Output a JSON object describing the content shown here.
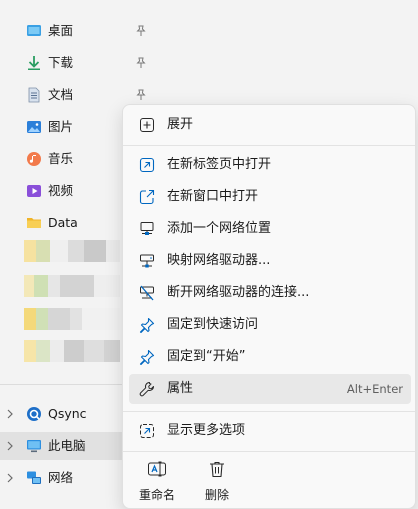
{
  "nav": {
    "pinned": [
      {
        "label": "桌面",
        "icon": "desktop-icon"
      },
      {
        "label": "下载",
        "icon": "download-icon"
      },
      {
        "label": "文档",
        "icon": "document-icon"
      },
      {
        "label": "图片",
        "icon": "pictures-icon"
      },
      {
        "label": "音乐",
        "icon": "music-icon"
      },
      {
        "label": "视频",
        "icon": "video-icon"
      },
      {
        "label": "Data",
        "icon": "folder-icon"
      }
    ],
    "tree": [
      {
        "label": "Qsync",
        "icon": "qsync-icon"
      },
      {
        "label": "此电脑",
        "icon": "computer-icon"
      },
      {
        "label": "网络",
        "icon": "network-icon"
      }
    ]
  },
  "menu": {
    "expand": "展开",
    "items": [
      {
        "label": "在新标签页中打开",
        "icon": "open-new-tab-icon"
      },
      {
        "label": "在新窗口中打开",
        "icon": "open-new-window-icon"
      },
      {
        "label": "添加一个网络位置",
        "icon": "network-location-icon"
      },
      {
        "label": "映射网络驱动器...",
        "icon": "map-drive-icon"
      },
      {
        "label": "断开网络驱动器的连接...",
        "icon": "disconnect-drive-icon"
      },
      {
        "label": "固定到快速访问",
        "icon": "pin-icon"
      },
      {
        "label": "固定到“开始”",
        "icon": "pin-start-icon"
      }
    ],
    "properties": {
      "label": "属性",
      "shortcut": "Alt+Enter"
    },
    "more": "显示更多选项",
    "rename": "重命名",
    "delete": "删除"
  },
  "colors": {
    "accent": "#0067c0",
    "selected": "#e1e1e1",
    "hover": "#e8e8e8"
  }
}
